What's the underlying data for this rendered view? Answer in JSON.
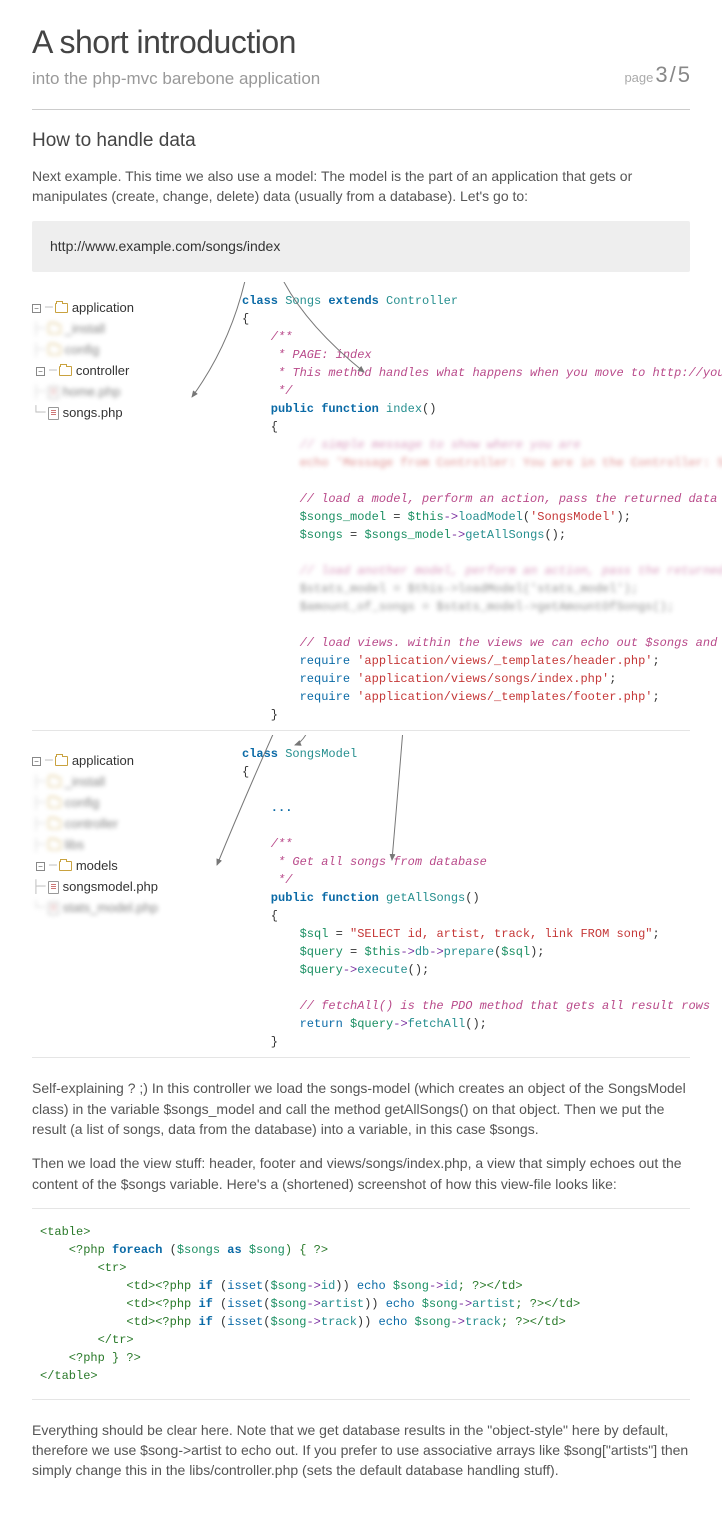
{
  "header": {
    "title": "A short introduction",
    "subtitle": "into the php-mvc barebone application",
    "page_label": "page",
    "page_current": "3",
    "page_sep": "/",
    "page_total": "5"
  },
  "section_title": "How to handle data",
  "intro": "Next example. This time we also use a model: The model is the part of an application that gets or manipulates (create, change, delete) data (usually from a database). Let's go to:",
  "url": "http://www.example.com/songs/index",
  "tree1": {
    "root": "application",
    "blur1": "_install",
    "blur2": "config",
    "folder": "controller",
    "blurfile": "home.php",
    "file": "songs.php"
  },
  "code1": {
    "l1a": "class ",
    "l1b": "Songs",
    "l1c": " extends ",
    "l1d": "Controller",
    "l2": "{",
    "c1": "    /**",
    "c2": "     * PAGE: index",
    "c3": "     * This method handles what happens when you move to http://yourproject/songs/index",
    "c4": "     */",
    "l3a": "    public function ",
    "l3b": "index",
    "l3c": "()",
    "l4": "    {",
    "bl1": "        // simple message to show where you are",
    "bl2": "        echo 'Message from Controller: You are in the Controller: Songs, using the",
    "c5": "        // load a model, perform an action, pass the returned data to a variable",
    "l5a": "        $songs_model",
    "l5b": " = ",
    "l5c": "$this",
    "l5d": "->",
    "l5e": "loadModel",
    "l5f": "(",
    "l5g": "'SongsModel'",
    "l5h": ");",
    "l6a": "        $songs",
    "l6b": " = ",
    "l6c": "$songs_model",
    "l6d": "->",
    "l6e": "getAllSongs",
    "l6f": "();",
    "bl3": "        // load another model, perform an action, pass the returned data to a variable",
    "bl4": "        $stats_model = $this->loadModel('stats_model');",
    "bl5": "        $amount_of_songs = $stats_model->getAmountOfSongs();",
    "c6": "        // load views. within the views we can echo out $songs and $amount_of_songs",
    "l7a": "        require ",
    "l7b": "'application/views/_templates/header.php'",
    "l7c": ";",
    "l8a": "        require ",
    "l8b": "'application/views/songs/index.php'",
    "l8c": ";",
    "l9a": "        require ",
    "l9b": "'application/views/_templates/footer.php'",
    "l9c": ";",
    "l10": "    }"
  },
  "tree2": {
    "root": "application",
    "blur1": "_install",
    "blur2": "config",
    "blur3": "controller",
    "blur4": "libs",
    "folder": "models",
    "file": "songsmodel.php",
    "blurfile": "stats_model.php"
  },
  "code2": {
    "l1a": "class ",
    "l1b": "SongsModel",
    "l2": "{",
    "dots": "    ...",
    "c1": "    /**",
    "c2": "     * Get all songs from database",
    "c3": "     */",
    "l3a": "    public function ",
    "l3b": "getAllSongs",
    "l3c": "()",
    "l4": "    {",
    "l5a": "        $sql",
    "l5b": " = ",
    "l5c": "\"SELECT id, artist, track, link FROM song\"",
    "l5d": ";",
    "l6a": "        $query",
    "l6b": " = ",
    "l6c": "$this",
    "l6d": "->",
    "l6e": "db",
    "l6f": "->",
    "l6g": "prepare",
    "l6h": "(",
    "l6i": "$sql",
    "l6j": ");",
    "l7a": "        $query",
    "l7b": "->",
    "l7c": "execute",
    "l7d": "();",
    "c4": "        // fetchAll() is the PDO method that gets all result rows",
    "l8a": "        return ",
    "l8b": "$query",
    "l8c": "->",
    "l8d": "fetchAll",
    "l8e": "();",
    "l9": "    }"
  },
  "para1": "Self-explaining ? ;) In this controller we load the songs-model (which creates an object of the SongsModel class) in the variable $songs_model and call the method getAllSongs() on that object. Then we put the result (a list of songs, data from the database) into a variable, in this case $songs.",
  "para2": "Then we load the view stuff: header, footer and views/songs/index.php, a view that simply echoes out the content of the $songs variable. Here's a (shortened) screenshot of how this view-file looks like:",
  "code3": {
    "l1": "<table>",
    "l2a": "    <?php ",
    "l2b": "foreach ",
    "l2c": "(",
    "l2d": "$songs",
    "l2e": " as ",
    "l2f": "$song",
    "l2g": ") { ?>",
    "l3": "        <tr>",
    "l4a": "            <td>",
    "l4b": "<?php ",
    "l4c": "if ",
    "l4d": "(",
    "l4e": "isset",
    "l4f": "(",
    "l4g": "$song",
    "l4h": "->",
    "l4i": "id",
    "l4j": ")) ",
    "l4k": "echo ",
    "l4l": "$song",
    "l4m": "->",
    "l4n": "id",
    "l4o": "; ?>",
    "l4p": "</td>",
    "l5a": "            <td>",
    "l5b": "<?php ",
    "l5c": "if ",
    "l5d": "(",
    "l5e": "isset",
    "l5f": "(",
    "l5g": "$song",
    "l5h": "->",
    "l5i": "artist",
    "l5j": ")) ",
    "l5k": "echo ",
    "l5l": "$song",
    "l5m": "->",
    "l5n": "artist",
    "l5o": "; ?>",
    "l5p": "</td>",
    "l6a": "            <td>",
    "l6b": "<?php ",
    "l6c": "if ",
    "l6d": "(",
    "l6e": "isset",
    "l6f": "(",
    "l6g": "$song",
    "l6h": "->",
    "l6i": "track",
    "l6j": ")) ",
    "l6k": "echo ",
    "l6l": "$song",
    "l6m": "->",
    "l6n": "track",
    "l6o": "; ?>",
    "l6p": "</td>",
    "l7": "        </tr>",
    "l8": "    <?php } ?>",
    "l9": "</table>"
  },
  "para3": "Everything should be clear here. Note that we get database results in the \"object-style\" here by default, therefore we use $song->artist to echo out. If you prefer to use associative arrays like $song[\"artists\"] then simply change this in the libs/controller.php (sets the default database handling stuff)."
}
